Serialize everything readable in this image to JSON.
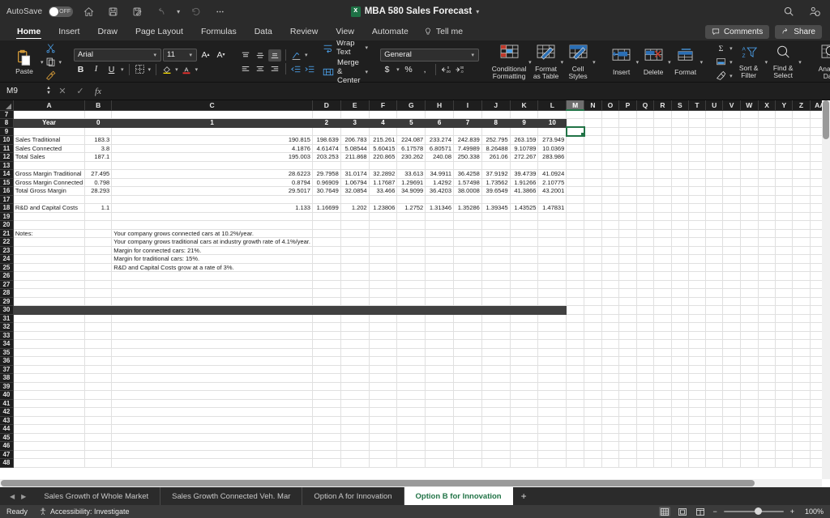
{
  "titlebar": {
    "autosave_label": "AutoSave",
    "autosave_state": "OFF",
    "doc_title": "MBA 580 Sales Forecast",
    "icons": [
      "home-icon",
      "save-icon",
      "save-as-icon",
      "undo-icon",
      "redo-icon",
      "more-icon",
      "search-icon",
      "account-icon"
    ]
  },
  "ribbon_tabs": {
    "items": [
      {
        "label": "Home",
        "active": true
      },
      {
        "label": "Insert",
        "active": false
      },
      {
        "label": "Draw",
        "active": false
      },
      {
        "label": "Page Layout",
        "active": false
      },
      {
        "label": "Formulas",
        "active": false
      },
      {
        "label": "Data",
        "active": false
      },
      {
        "label": "Review",
        "active": false
      },
      {
        "label": "View",
        "active": false
      },
      {
        "label": "Automate",
        "active": false
      }
    ],
    "tell_me": "Tell me",
    "comments": "Comments",
    "share": "Share"
  },
  "ribbon": {
    "paste": "Paste",
    "font_name": "Arial",
    "font_size": "11",
    "bold": "B",
    "italic": "I",
    "underline": "U",
    "wrap_text": "Wrap Text",
    "merge_center": "Merge & Center",
    "number_format": "General",
    "currency": "$",
    "percent": "%",
    "comma": " ,",
    "conditional_formatting": "Conditional Formatting",
    "format_as_table": "Format as Table",
    "cell_styles": "Cell Styles",
    "insert": "Insert",
    "delete": "Delete",
    "format": "Format",
    "sort_filter": "Sort & Filter",
    "find_select": "Find & Select",
    "analyze_data": "Analyze Data"
  },
  "formula_bar": {
    "name_box": "M9",
    "formula": "",
    "cancel_icon": "cancel-icon",
    "confirm_icon": "confirm-icon",
    "fx_icon": "function-icon"
  },
  "grid": {
    "columns": [
      "A",
      "B",
      "C",
      "D",
      "E",
      "F",
      "G",
      "H",
      "I",
      "J",
      "K",
      "L",
      "M",
      "N",
      "O",
      "P",
      "Q",
      "R",
      "S",
      "T",
      "U",
      "V",
      "W",
      "X",
      "Y",
      "Z",
      "AA"
    ],
    "selected_column": "M",
    "selected_cell": "M9",
    "first_row": 7,
    "last_row": 48,
    "header_row_number": 8,
    "header_label": "Year",
    "year_columns": [
      "0",
      "1",
      "2",
      "3",
      "4",
      "5",
      "6",
      "7",
      "8",
      "9",
      "10"
    ],
    "rows": [
      {
        "n": 10,
        "label": "Sales Traditional",
        "values": [
          "183.3",
          "190.815",
          "198.639",
          "206.783",
          "215.261",
          "224.087",
          "233.274",
          "242.839",
          "252.795",
          "263.159",
          "273.949"
        ]
      },
      {
        "n": 11,
        "label": "Sales Connected",
        "values": [
          "3.8",
          "4.1876",
          "4.61474",
          "5.08544",
          "5.60415",
          "6.17578",
          "6.80571",
          "7.49989",
          "8.26488",
          "9.10789",
          "10.0369"
        ]
      },
      {
        "n": 12,
        "label": "Total Sales",
        "values": [
          "187.1",
          "195.003",
          "203.253",
          "211.868",
          "220.865",
          "230.262",
          "240.08",
          "250.338",
          "261.06",
          "272.267",
          "283.986"
        ]
      },
      {
        "n": 14,
        "label": "Gross Margin Traditional",
        "values": [
          "27.495",
          "28.6223",
          "29.7958",
          "31.0174",
          "32.2892",
          "33.613",
          "34.9911",
          "36.4258",
          "37.9192",
          "39.4739",
          "41.0924"
        ]
      },
      {
        "n": 15,
        "label": "Gross Margin Connected",
        "values": [
          "0.798",
          "0.8794",
          "0.96909",
          "1.06794",
          "1.17687",
          "1.29691",
          "1.4292",
          "1.57498",
          "1.73562",
          "1.91266",
          "2.10775"
        ]
      },
      {
        "n": 16,
        "label": "Total Gross Margin",
        "values": [
          "28.293",
          "29.5017",
          "30.7649",
          "32.0854",
          "33.466",
          "34.9099",
          "36.4203",
          "38.0008",
          "39.6549",
          "41.3866",
          "43.2001"
        ]
      },
      {
        "n": 18,
        "label": "R&D and Capital Costs",
        "values": [
          "1.1",
          "1.133",
          "1.16699",
          "1.202",
          "1.23806",
          "1.2752",
          "1.31346",
          "1.35286",
          "1.39345",
          "1.43525",
          "1.47831"
        ]
      }
    ],
    "notes_label": "Notes:",
    "notes": [
      {
        "n": 21,
        "text": "Your company grows connected cars at 10.2%/year."
      },
      {
        "n": 22,
        "text": "Your company grows traditional cars at industry growth rate of 4.1%/year."
      },
      {
        "n": 23,
        "text": "Margin for connected cars: 21%."
      },
      {
        "n": 24,
        "text": "Margin for traditional cars: 15%."
      },
      {
        "n": 25,
        "text": "R&D and Capital Costs grow at a rate of 3%."
      }
    ],
    "banded_row": 30,
    "accent_color": "#217346"
  },
  "sheet_tabs": {
    "items": [
      {
        "label": "Sales Growth of Whole Market",
        "active": false
      },
      {
        "label": "Sales Growth Connected Veh. Mar",
        "active": false
      },
      {
        "label": "Option A for Innovation",
        "active": false
      },
      {
        "label": "Option B for Innovation",
        "active": true
      }
    ],
    "add_label": "+"
  },
  "status_bar": {
    "ready": "Ready",
    "accessibility": "Accessibility: Investigate",
    "zoom": "100%",
    "zoom_out": "−",
    "zoom_in": "+"
  }
}
